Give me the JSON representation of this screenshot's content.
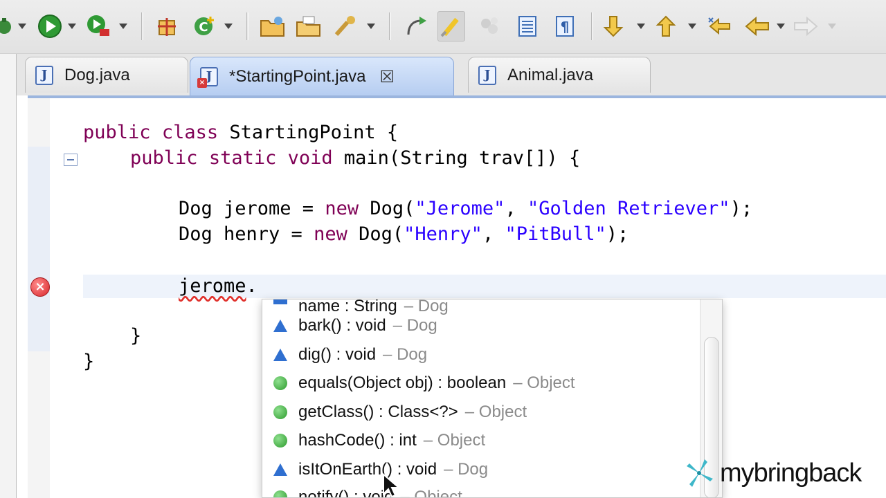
{
  "colors": {
    "keyword": "#7f0055",
    "string": "#2a00ff",
    "owner_text": "#8a8a8a",
    "error": "#d8262b",
    "tab_active": "#b6cdf1"
  },
  "toolbar": {
    "buttons": [
      {
        "icon": "debug-icon"
      },
      {
        "icon": "run-icon"
      },
      {
        "icon": "run-external-tool-icon"
      },
      {
        "icon": "new-java-project-icon"
      },
      {
        "icon": "new-class-icon"
      },
      {
        "icon": "open-type-icon"
      },
      {
        "icon": "open-task-icon"
      },
      {
        "icon": "search-icon"
      },
      {
        "icon": "toggle-breadcrumb-icon"
      },
      {
        "icon": "mark-occurrences-icon"
      },
      {
        "icon": "block-selection-icon"
      },
      {
        "icon": "show-whitespace-icon"
      },
      {
        "icon": "paragraph-icon"
      },
      {
        "icon": "next-annotation-icon"
      },
      {
        "icon": "previous-annotation-icon"
      },
      {
        "icon": "last-edit-location-icon"
      },
      {
        "icon": "back-icon"
      },
      {
        "icon": "forward-icon"
      }
    ]
  },
  "tabs": [
    {
      "label": "Dog.java",
      "icon_letter": "J",
      "active": false
    },
    {
      "label": "*StartingPoint.java",
      "icon_letter": "J",
      "active": true,
      "close": "☒"
    },
    {
      "label": "Animal.java",
      "icon_letter": "J",
      "active": false
    }
  ],
  "code": {
    "line1": {
      "kw1": "public",
      "kw2": "class",
      "rest": " StartingPoint {"
    },
    "line2": {
      "kw1": "public",
      "kw2": "static",
      "kw3": "void",
      "rest": " main(String trav[]) {"
    },
    "line3": {
      "pre": "Dog jerome = ",
      "kw": "new",
      "mid": " Dog(",
      "s1": "\"Jerome\"",
      "comma": ", ",
      "s2": "\"Golden Retriever\"",
      "end": ");"
    },
    "line4": {
      "pre": "Dog henry = ",
      "kw": "new",
      "mid": " Dog(",
      "s1": "\"Henry\"",
      "comma": ", ",
      "s2": "\"PitBull\"",
      "end": ");"
    },
    "line5": {
      "ident": "jerome",
      "dot": "."
    },
    "line6": "}",
    "line7": "}"
  },
  "completion": {
    "items": [
      {
        "sig": "name : String",
        "owner": "– Dog",
        "marker": "field"
      },
      {
        "sig": "bark() : void",
        "owner": "– Dog",
        "marker": "method-default"
      },
      {
        "sig": "dig() : void",
        "owner": "– Dog",
        "marker": "method-default"
      },
      {
        "sig": "equals(Object obj) : boolean",
        "owner": "– Object",
        "marker": "method-public"
      },
      {
        "sig": "getClass() : Class<?>",
        "owner": "– Object",
        "marker": "method-public"
      },
      {
        "sig": "hashCode() : int",
        "owner": "– Object",
        "marker": "method-public"
      },
      {
        "sig": "isItOnEarth() : void",
        "owner": "– Dog",
        "marker": "method-default"
      },
      {
        "sig": "notify() : void",
        "owner": "– Object",
        "marker": "method-public"
      }
    ]
  },
  "watermark": {
    "text": "mybringback"
  }
}
